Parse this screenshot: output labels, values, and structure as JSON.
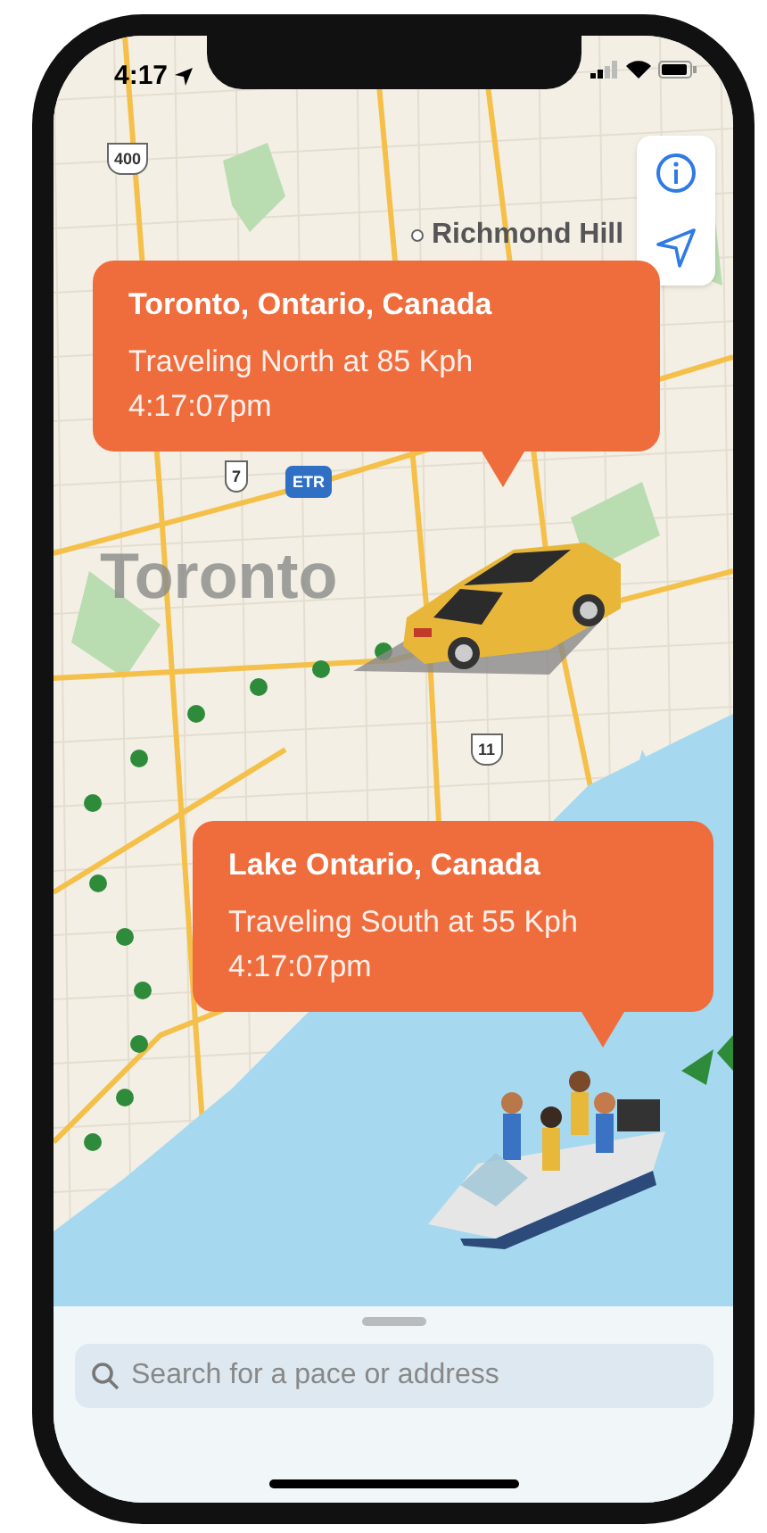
{
  "status_bar": {
    "time": "4:17",
    "location_arrow": true
  },
  "map": {
    "place_labels": [
      {
        "text": "Richmond Hill",
        "kind": "town"
      },
      {
        "text": "Toronto",
        "kind": "city"
      }
    ],
    "route_shields": [
      {
        "text": "400",
        "kind": "shield"
      },
      {
        "text": "7",
        "kind": "shield"
      },
      {
        "text": "ETR",
        "kind": "badge"
      },
      {
        "text": "11",
        "kind": "shield"
      }
    ],
    "callouts": [
      {
        "title": "Toronto, Ontario, Canada",
        "line_1": "Traveling North at 85 Kph",
        "line_2": "4:17:07pm"
      },
      {
        "title": "Lake Ontario, Canada",
        "line_1": "Traveling South at 55 Kph",
        "line_2": "4:17:07pm"
      }
    ]
  },
  "search": {
    "placeholder": "Search for a pace or address"
  }
}
